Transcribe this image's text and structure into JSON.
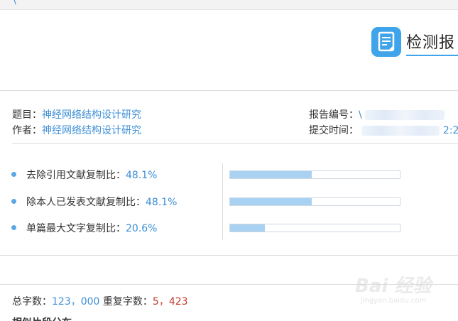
{
  "topbar": {
    "glyph": "\\"
  },
  "header": {
    "title": "检测报"
  },
  "meta": {
    "title_label": "题目：",
    "title_value": "神经网络结构设计研究",
    "author_label": "作者：",
    "author_value": "神经网络结构设计研究",
    "report_no_label": "报告编号：",
    "report_no_value": "\\",
    "submit_time_label": "提交时间：",
    "submit_time_value": "2:2"
  },
  "ratios": [
    {
      "label": "去除引用文献复制比：",
      "value": "48.1%",
      "fraction": 0.481
    },
    {
      "label": "除本人已发表文献复制比：",
      "value": "48.1%",
      "fraction": 0.481
    },
    {
      "label": "单篇最大文字复制比：",
      "value": "20.6%",
      "fraction": 0.206
    }
  ],
  "stats": {
    "total_label": "总字数：",
    "total_value": "123，000",
    "repeat_label": "重复字数：",
    "repeat_value": "5，423"
  },
  "next_section_heading": "相似片段分布",
  "watermark": {
    "main": "Bai  经验",
    "sub": "jingyan.baidu.com"
  },
  "colors": {
    "accent": "#3fa4ea",
    "link": "#3d8fd6",
    "bar_fill": "#a9d1f2",
    "repeat": "#c0392b"
  }
}
